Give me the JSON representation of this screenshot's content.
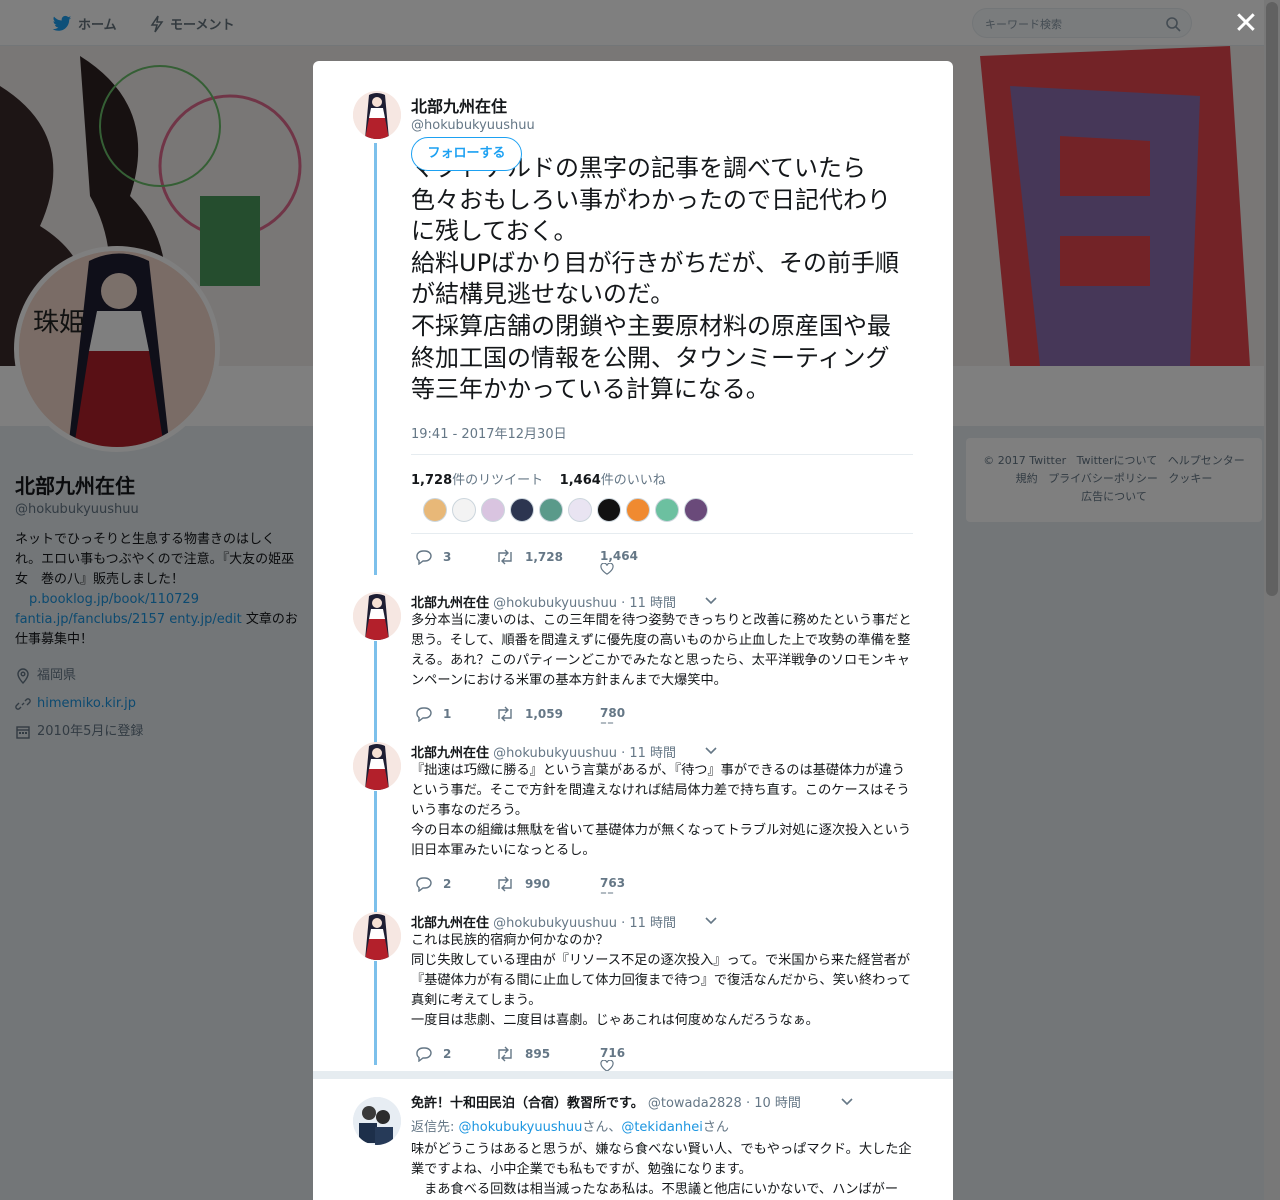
{
  "nav": {
    "home": "ホーム",
    "moments": "モーメント",
    "search_placeholder": "キーワード検索"
  },
  "profile": {
    "name": "北部九州在住",
    "handle": "@hokubukyuushuu",
    "bio_1": "ネットでひっそりと生息する物書きのはしくれ。エロい事もつぶやくので注意。『大友の姫巫女　巻の八』販売しました！",
    "bio_link1": "p.booklog.jp/book/110729",
    "bio_link2": "fantia.jp/fanclubs/2157",
    "bio_link3": "enty.jp/edit",
    "bio_2": "文章のお仕事募集中！",
    "location": "福岡県",
    "website": "himemiko.kir.jp",
    "joined": "2010年5月に登録",
    "avatar_text": "珠姫"
  },
  "footer": {
    "copyright": "© 2017 Twitter",
    "about": "Twitterについて",
    "help": "ヘルプセンター",
    "terms": "規約",
    "privacy": "プライバシーポリシー",
    "cookies": "クッキー",
    "ads": "広告について"
  },
  "modal": {
    "author_name": "北部九州在住",
    "author_handle": "@hokubukyuushuu",
    "follow_label": "フォローする",
    "main_text": "マクドナルドの黒字の記事を調べていたら色々おもしろい事がわかったので日記代わりに残しておく。\n給料UPばかり目が行きがちだが、その前手順が結構見逃せないのだ。\n不採算店舗の閉鎖や主要原材料の原産国や最終加工国の情報を公開、タウンミーティング等三年かかっている計算になる。",
    "timestamp": "19:41 - 2017年12月30日",
    "retweets_count": "1,728",
    "retweets_label": "件のリツイート",
    "likes_count": "1,464",
    "likes_label": "件のいいね",
    "actions": {
      "reply": "3",
      "retweet": "1,728",
      "like": "1,464"
    }
  },
  "replies": [
    {
      "name": "北部九州在住",
      "handle": "@hokubukyuushuu",
      "time": "· 11 時間",
      "text": "多分本当に凄いのは、この三年間を待つ姿勢できっちりと改善に務めたという事だと思う。そして、順番を間違えずに優先度の高いものから止血した上で攻勢の準備を整える。あれ？このパティーンどこかでみたなと思ったら、太平洋戦争のソロモンキャンペーンにおける米軍の基本方針まんまで大爆笑中。",
      "reply": "1",
      "retweet": "1,059",
      "like": "780"
    },
    {
      "name": "北部九州在住",
      "handle": "@hokubukyuushuu",
      "time": "· 11 時間",
      "text": "『拙速は巧緻に勝る』という言葉があるが、『待つ』事ができるのは基礎体力が違うという事だ。そこで方針を間違えなければ結局体力差で持ち直す。このケースはそういう事なのだろう。\n今の日本の組織は無駄を省いて基礎体力が無くなってトラブル対処に逐次投入という旧日本軍みたいになっとるし。",
      "reply": "2",
      "retweet": "990",
      "like": "763"
    },
    {
      "name": "北部九州在住",
      "handle": "@hokubukyuushuu",
      "time": "· 11 時間",
      "text": "これは民族的宿痾か何かなのか？\n同じ失敗している理由が『リソース不足の逐次投入』って。で米国から来た経営者が『基礎体力が有る間に止血して体力回復まで待つ』で復活なんだから、笑い終わって真剣に考えてしまう。\n一度目は悲劇、二度目は喜劇。じゃあこれは何度めなんだろうなぁ。",
      "reply": "2",
      "retweet": "895",
      "like": "716"
    }
  ],
  "other_reply": {
    "name": "免許！十和田民泊（合宿）教習所です。",
    "handle": "@towada2828",
    "time": "· 10 時間",
    "reply_to_label": "返信先:",
    "mention1": "@hokubukyuushuu",
    "san1": "さん、",
    "mention2": "@tekidanhei",
    "san2": "さん",
    "text": "味がどうこうはあると思うが、嫌なら食べない賢い人、でもやっぱマクド。大した企業ですよね、小中企業でも私もですが、勉強になります。\n　まあ食べる回数は相当減ったなあ私は。不思議と他店にいかないで、ハンばがー"
  },
  "colors": {
    "accent": "#1da1f2",
    "thread": "#7cc0eb",
    "banner_purple": "#8c6fb0"
  },
  "icons": [
    "twitter-bird-icon",
    "lightning-icon",
    "search-icon",
    "close-icon",
    "location-icon",
    "link-icon",
    "calendar-icon",
    "reply-icon",
    "retweet-icon",
    "heart-icon",
    "chevron-down-icon"
  ]
}
